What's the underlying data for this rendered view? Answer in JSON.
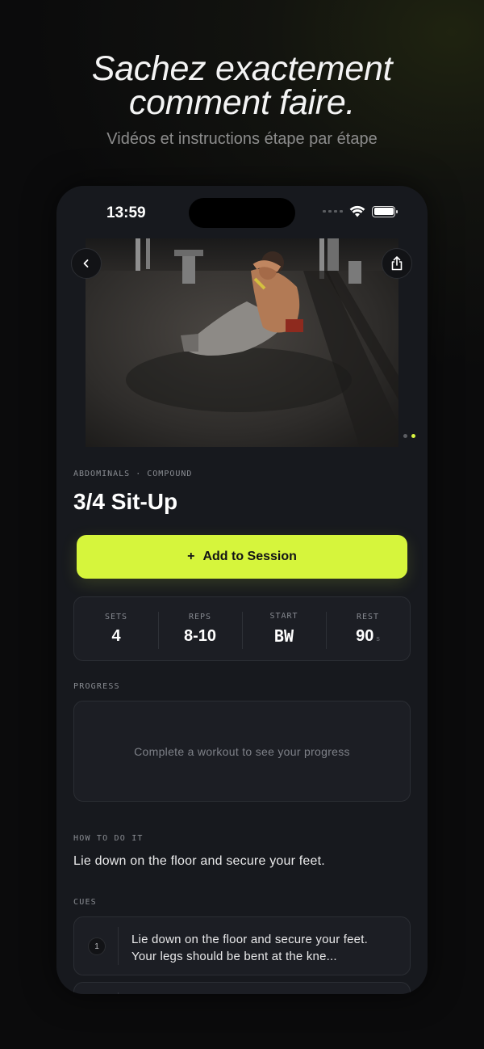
{
  "promo": {
    "headline_line1": "Sachez exactement",
    "headline_line2": "comment faire.",
    "subheadline": "Vidéos et instructions étape par étape"
  },
  "status_bar": {
    "time": "13:59",
    "icons": [
      "cellular-signal-icon",
      "wifi-icon",
      "battery-icon"
    ]
  },
  "media": {
    "image_alt": "man performing sit-up on gym floor",
    "page_count": 2,
    "active_page": 2
  },
  "exercise": {
    "meta": "ABDOMINALS · COMPOUND",
    "title": "3/4 Sit-Up"
  },
  "actions": {
    "add_icon": "+",
    "add_label": "Add to Session"
  },
  "stats": [
    {
      "label": "SETS",
      "value": "4",
      "unit": ""
    },
    {
      "label": "REPS",
      "value": "8-10",
      "unit": ""
    },
    {
      "label": "START",
      "value": "BW",
      "unit": ""
    },
    {
      "label": "REST",
      "value": "90",
      "unit": "s"
    }
  ],
  "progress": {
    "label": "PROGRESS",
    "empty_message": "Complete a workout to see your progress"
  },
  "how_to": {
    "label": "HOW TO DO IT",
    "text": "Lie down on the floor and secure your feet."
  },
  "cues": {
    "label": "CUES",
    "items": [
      {
        "number": "1",
        "line1": "Lie down on the floor and secure your feet.",
        "line2": "Your legs should be bent at the kne..."
      }
    ]
  },
  "colors": {
    "accent": "#d6f53c",
    "background": "#17191e",
    "card": "#1c1e24"
  }
}
